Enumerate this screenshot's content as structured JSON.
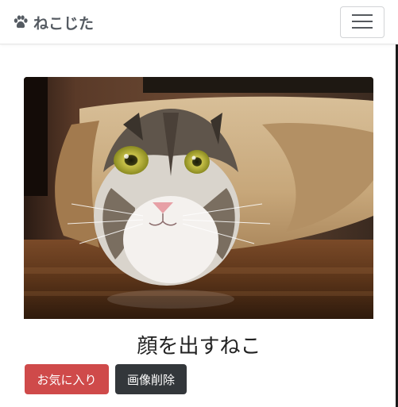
{
  "navbar": {
    "brand_label": "ねこじた",
    "brand_icon": "paw-icon",
    "toggle_icon": "hamburger-menu-icon"
  },
  "post": {
    "image_description_icon": "cat-photo",
    "title": "顔を出すねこ",
    "favorite_label": "お気に入り",
    "delete_label": "画像削除"
  },
  "colors": {
    "favorite_button": "#cf4a4a",
    "delete_button": "#33373b",
    "brand_text": "#555b62"
  }
}
